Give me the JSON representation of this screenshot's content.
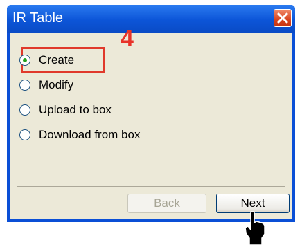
{
  "window": {
    "title": "IR Table",
    "close_icon": "close-icon"
  },
  "annotation": {
    "step_number": "4",
    "highlight_color": "#e0392b"
  },
  "options": [
    {
      "label": "Create",
      "checked": true
    },
    {
      "label": "Modify",
      "checked": false
    },
    {
      "label": "Upload to box",
      "checked": false
    },
    {
      "label": "Download from box",
      "checked": false
    }
  ],
  "buttons": {
    "back_label": "Back",
    "back_enabled": false,
    "next_label": "Next"
  },
  "cursor": {
    "icon": "hand-pointer-icon"
  },
  "colors": {
    "titlebar": "#0c55d8",
    "client_background": "#ece9d8",
    "close_button": "#d9441f",
    "radio_dot": "#21a121"
  }
}
